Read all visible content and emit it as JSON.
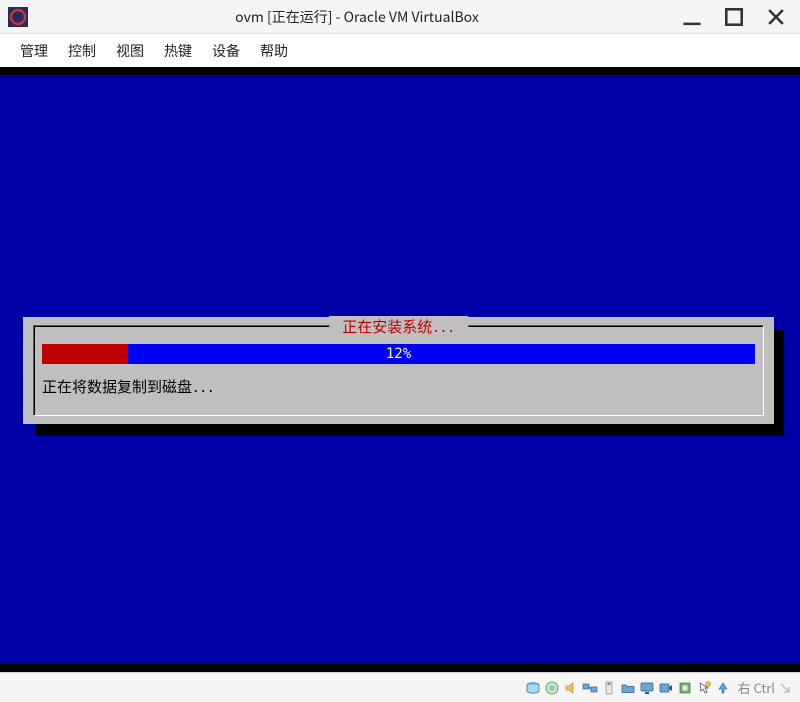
{
  "window": {
    "title": "ovm [正在运行] - Oracle VM VirtualBox"
  },
  "menubar": {
    "items": [
      "管理",
      "控制",
      "视图",
      "热键",
      "设备",
      "帮助"
    ]
  },
  "installer": {
    "dialog_title": " 正在安装系统... ",
    "progress_percent": 12,
    "progress_label": "12%",
    "status_text": "正在将数据复制到磁盘..."
  },
  "statusbar": {
    "hostkey_label": "右 Ctrl"
  }
}
